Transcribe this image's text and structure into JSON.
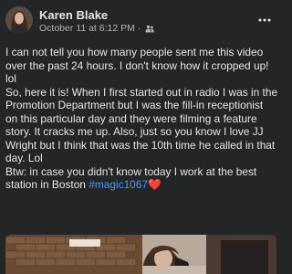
{
  "post": {
    "author": "Karen Blake",
    "date": "October 11 at 6:12 PM",
    "separator": "·",
    "audience_icon": "friends-icon",
    "more_icon": "more-options-icon",
    "lines": [
      "I can not tell you how many people sent me this video",
      "over the past 24 hours. I don't know how it cropped up!",
      "lol",
      "So, here it is! When I first started out in radio I was in the",
      "Promotion Department but I was the fill-in receptionist",
      "on this particular day and they were filming a feature",
      "story. It cracks me up. Also, just so you know I love JJ",
      "Wright but I think that was the 10th time he called in that",
      "day. Lol",
      "Btw: in case you didn't know today I work at the best"
    ],
    "last_line_text": "station in Boston",
    "hashtag": "#magic1067",
    "heart": "❤️"
  },
  "colors": {
    "background": "#242526",
    "text": "#e4e6eb",
    "secondary_text": "#b0b3b8",
    "hashtag": "#4599ff"
  }
}
